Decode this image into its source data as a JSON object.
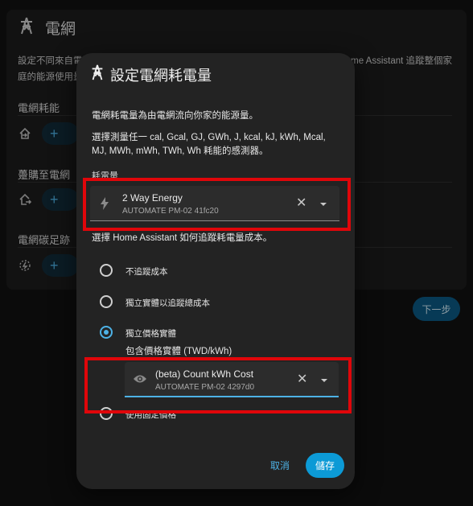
{
  "background": {
    "title": "電網",
    "desc_left_1": "設定不同來自電",
    "desc_right_1": "me Assistant 追蹤整個家",
    "desc_left_2": "庭的能源使用量",
    "sections": [
      {
        "label": "電網耗能",
        "icon": "home-import-icon"
      },
      {
        "label": "躉購至電網",
        "icon": "home-export-icon"
      },
      {
        "label": "電網碳足跡",
        "icon": "carbon-icon"
      }
    ],
    "add_symbol": "+",
    "next_label": "下一步"
  },
  "dialog": {
    "title": "設定電網耗電量",
    "intro": "電網耗電量為由電網流向你家的能源量。",
    "sensor_help": "選擇測量任一 cal, Gcal, GJ, GWh, J, kcal, kJ, kWh, Mcal, MJ, MWh, mWh, TWh, Wh 耗能的感測器。",
    "consumption_label": "耗電量",
    "sensor_field": {
      "title": "2 Way Energy",
      "subtitle": "AUTOMATE PM-02 41fc20",
      "icon": "lightning-icon"
    },
    "cost_prompt": "選擇 Home Assistant 如何追蹤耗電量成本。",
    "options": [
      {
        "label": "不追蹤成本",
        "selected": false
      },
      {
        "label": "獨立實體以追蹤總成本",
        "selected": false
      },
      {
        "label": "獨立價格實體",
        "selected": true
      },
      {
        "label": "使用固定價格",
        "selected": false
      }
    ],
    "price_entity_label": "包含價格實體 (TWD/kWh)",
    "price_field": {
      "title": "(beta) Count kWh Cost",
      "subtitle": "AUTOMATE PM-02 4297d0",
      "icon": "eye-icon"
    },
    "clear_symbol": "✕",
    "cancel_label": "取消",
    "save_label": "儲存"
  },
  "colors": {
    "accent": "#4db2e6",
    "save_bg": "#0c9ad6",
    "highlight": "#e0060a"
  }
}
